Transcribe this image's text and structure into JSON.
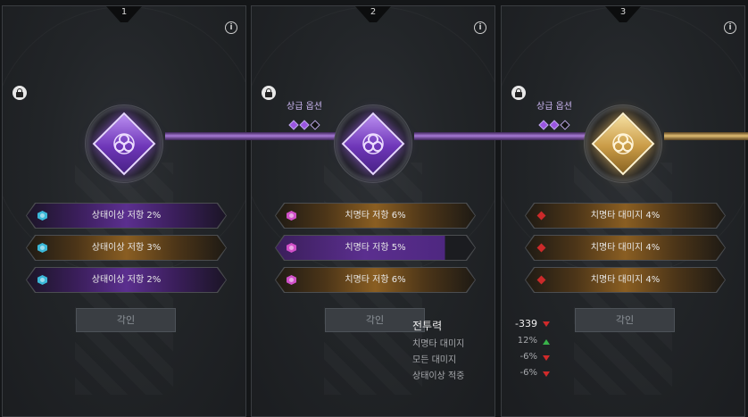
{
  "colors": {
    "purple": "#9a55e0",
    "gold": "#d4a555",
    "cyan": "#3bb8d8",
    "pink": "#d050c8",
    "red": "#cc2a2a",
    "green": "#39b34a"
  },
  "panels": [
    {
      "number": "1",
      "info_icon": "i",
      "lock_icon": "lock-icon",
      "upgrade": null,
      "medal_style": "purple",
      "options": [
        {
          "label": "상태이상 저항 2%",
          "style": "purple",
          "icon": "cyan-hex-gem-icon"
        },
        {
          "label": "상태이상 저항 3%",
          "style": "gold",
          "icon": "cyan-hex-gem-icon"
        },
        {
          "label": "상태이상 저항 2%",
          "style": "purple",
          "icon": "cyan-hex-gem-icon"
        }
      ],
      "button": "각인"
    },
    {
      "number": "2",
      "info_icon": "i",
      "lock_icon": "lock-icon",
      "upgrade": {
        "label": "상급 옵션",
        "filled": 2,
        "total": 3
      },
      "medal_style": "purple",
      "options": [
        {
          "label": "치명타 저항 6%",
          "style": "gold",
          "icon": "pink-hex-gem-icon"
        },
        {
          "label": "치명타 저항 5%",
          "style": "bar",
          "icon": "pink-hex-gem-icon",
          "fill_percent": 83
        },
        {
          "label": "치명타 저항 6%",
          "style": "gold",
          "icon": "pink-hex-gem-icon"
        }
      ],
      "button": "각인"
    },
    {
      "number": "3",
      "info_icon": "i",
      "lock_icon": "lock-icon",
      "upgrade": {
        "label": "상급 옵션",
        "filled": 2,
        "total": 3
      },
      "medal_style": "gold",
      "options": [
        {
          "label": "치명타 대미지 4%",
          "style": "gold",
          "icon": "red-diamond-gem-icon"
        },
        {
          "label": "치명타 대미지 4%",
          "style": "gold",
          "icon": "red-diamond-gem-icon"
        },
        {
          "label": "치명타 대미지 4%",
          "style": "gold",
          "icon": "red-diamond-gem-icon"
        }
      ],
      "button": "각인"
    }
  ],
  "tooltip": {
    "main": {
      "label": "전투력",
      "value": "-339",
      "trend": "down"
    },
    "rows": [
      {
        "label": "치명타 대미지",
        "value": "12%",
        "trend": "up"
      },
      {
        "label": "모든 대미지",
        "value": "-6%",
        "trend": "down"
      },
      {
        "label": "상태이상 적중",
        "value": "-6%",
        "trend": "down"
      }
    ]
  }
}
